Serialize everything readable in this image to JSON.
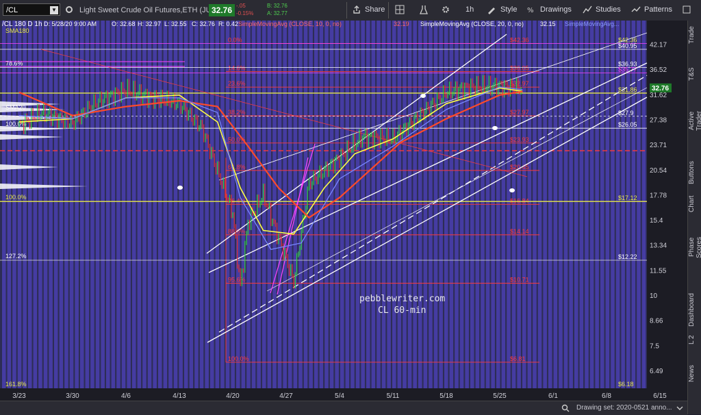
{
  "toolbar": {
    "symbol": "/CL",
    "title": "Light Sweet Crude Oil Futures,ETH (JUL 20)",
    "last": "32.76",
    "change": "-.05",
    "change_pct": "-0.15%",
    "bid": "B: 32.76",
    "ask": "A: 32.77",
    "share": "Share",
    "interval": "1h",
    "style": "Style",
    "drawings": "Drawings",
    "studies": "Studies",
    "patterns": "Patterns"
  },
  "sidebar": {
    "tabs": [
      "Trade",
      "T&S",
      "Active Trader",
      "Buttons",
      "Chart",
      "Phase Scores",
      "Dashboard",
      "L 2",
      "News"
    ]
  },
  "status": {
    "text": "Drawing set: 2020-0521 anno..."
  },
  "legend": {
    "header": "/CL 180 D 1h",
    "datetime": "D: 5/28/20 9:00 AM",
    "open": "O: 32.68",
    "high": "H: 32.97",
    "low": "L: 32.55",
    "close": "C: 32.76",
    "range": "R: 0.42",
    "sma10_label": "SimpleMovingAvg (CLOSE, 10, 0, no)",
    "sma10_value": "32.19",
    "sma20_label": "SimpleMovingAvg (CLOSE, 20, 0, no)",
    "sma20_value": "32.15",
    "sma_truncated": "SimpleMovingAvg...",
    "sma180": "SMA180",
    "sma20": "SMA20"
  },
  "watermark": {
    "line1": "pebblewriter.com",
    "line2": "CL 60-min"
  },
  "colors": {
    "background": "#2d2d55",
    "bar_band": "#4a3fb0",
    "fib": "#ff3a3a",
    "sma10": "#ffff44",
    "sma20": "#ff4a2a",
    "sma180": "#7788ff",
    "channel": "#ffffff",
    "magenta": "#ff44ff",
    "yellow_level": "#e8e84a"
  },
  "chart_data": {
    "type": "line",
    "title": "Light Sweet Crude Oil Futures,ETH (JUL 20) 60-min",
    "xlabel": "",
    "ylabel": "",
    "x_ticks": [
      "3/23",
      "3/30",
      "4/6",
      "4/13",
      "4/20",
      "4/27",
      "5/4",
      "5/11",
      "5/18",
      "5/25",
      "6/1",
      "6/8",
      "6/15"
    ],
    "y_ticks": [
      42.17,
      36.52,
      31.62,
      27.38,
      23.71,
      20.54,
      17.78,
      15.4,
      13.34,
      11.55,
      10,
      8.66,
      7.5,
      6.49
    ],
    "ylim": [
      6.1,
      45
    ],
    "log_scale": true,
    "grid": false,
    "series": [
      {
        "name": "Price",
        "x": [
          "3/23",
          "3/26",
          "3/30",
          "4/2",
          "4/6",
          "4/9",
          "4/13",
          "4/16",
          "4/20",
          "4/21",
          "4/22",
          "4/24",
          "4/27",
          "4/28",
          "4/30",
          "5/4",
          "5/7",
          "5/11",
          "5/14",
          "5/18",
          "5/21",
          "5/25",
          "5/28"
        ],
        "values": [
          26.5,
          28.5,
          26.8,
          30.2,
          32.5,
          31.2,
          30.0,
          26.0,
          16.0,
          10.5,
          15.2,
          17.8,
          12.3,
          10.8,
          19.0,
          22.0,
          24.8,
          24.5,
          27.5,
          32.0,
          33.0,
          33.2,
          32.76
        ]
      },
      {
        "name": "SMA10",
        "x": [
          "3/23",
          "3/30",
          "4/6",
          "4/13",
          "4/18",
          "4/21",
          "4/24",
          "4/28",
          "5/2",
          "5/6",
          "5/11",
          "5/18",
          "5/25",
          "5/28"
        ],
        "values": [
          27.0,
          27.5,
          31.0,
          31.5,
          27.0,
          18.5,
          14.5,
          14.2,
          18.5,
          22.5,
          24.5,
          30.0,
          32.8,
          32.19
        ]
      },
      {
        "name": "SMA20",
        "x": [
          "3/23",
          "3/30",
          "4/6",
          "4/13",
          "4/18",
          "4/22",
          "4/26",
          "4/30",
          "5/4",
          "5/8",
          "5/12",
          "5/18",
          "5/25",
          "5/28"
        ],
        "values": [
          32.0,
          28.0,
          29.5,
          30.5,
          29.5,
          23.5,
          18.5,
          15.6,
          17.5,
          20.5,
          24.0,
          27.5,
          31.5,
          32.15
        ]
      },
      {
        "name": "SMA180",
        "x": [
          "3/23",
          "3/30",
          "4/6",
          "4/13",
          "4/18",
          "4/21",
          "4/25",
          "4/29",
          "5/4",
          "5/11",
          "5/18",
          "5/25",
          "5/28"
        ],
        "values": [
          28.0,
          27.5,
          31.0,
          31.0,
          28.5,
          17.5,
          13.0,
          13.5,
          19.5,
          23.5,
          29.0,
          33.0,
          32.5
        ]
      }
    ],
    "fib_levels": [
      {
        "label": "0.0%",
        "value": 42.36
      },
      {
        "label": "14.6%",
        "value": 36.05
      },
      {
        "label": "23.6%",
        "value": 32.97
      },
      {
        "label": "38.2%",
        "value": 27.97
      },
      {
        "label": "50.0%",
        "value": 23.93
      },
      {
        "label": "61.8%",
        "value": 20.45
      },
      {
        "label": "76.4%",
        "value": 16.84
      },
      {
        "label": "88.6%",
        "value": 14.14
      },
      {
        "label": "95.6%",
        "value": 10.71
      },
      {
        "label": "100.0%",
        "value": 6.81
      }
    ],
    "horizontal_levels": [
      {
        "label": "78.6%",
        "value": 36.93
      },
      {
        "label": "100.0%",
        "value": 26.05
      },
      {
        "label": "100.0%",
        "value": 17.12
      },
      {
        "label": "127.2%",
        "value": 12.22
      },
      {
        "label": "161.8%",
        "value": 6.18
      }
    ],
    "right_labels": [
      "$42.36",
      "$40.95",
      "$36.93",
      "$35.77",
      "$31.86",
      "$27.9",
      "$26.05",
      "$17.12",
      "$12.22",
      "$6.18"
    ]
  }
}
